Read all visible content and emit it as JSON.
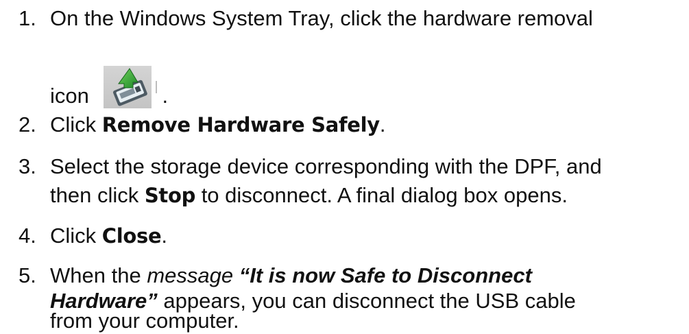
{
  "steps": [
    {
      "number": "1.",
      "line1": "On the Windows System Tray, click the hardware removal",
      "icon_word": "icon",
      "icon_name": "hardware-removal-icon",
      "end": "."
    },
    {
      "number": "2.",
      "pre": "Click ",
      "highlight": "Remove Hardware Safely",
      "post": "."
    },
    {
      "number": "3.",
      "line1": "Select the storage device corresponding with the DPF, and",
      "line2_pre": "then click ",
      "highlight": "Stop",
      "line2_post": " to disconnect. A final dialog box opens."
    },
    {
      "number": "4.",
      "pre": "Click ",
      "highlight": "Close",
      "post": "."
    },
    {
      "number": "5.",
      "line1_pre": "When the ",
      "line1_em": "message",
      "line1_space": " ",
      "line1_quote": "“It is now Safe to Disconnect",
      "line2_quote": "Hardware”",
      "line2_post": " appears, you can disconnect the USB cable",
      "line3": "from your computer."
    }
  ]
}
